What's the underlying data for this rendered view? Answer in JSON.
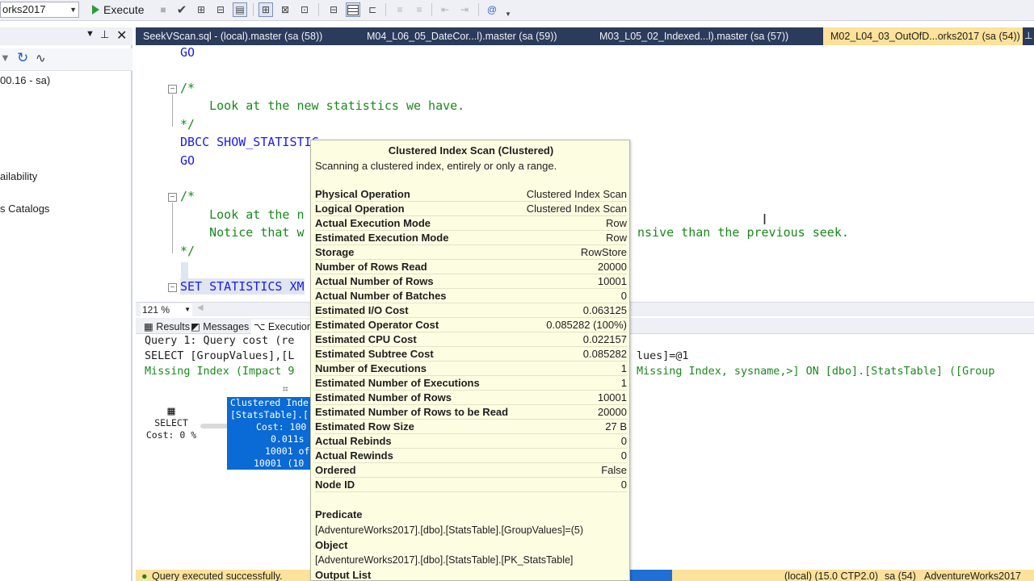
{
  "toolbar": {
    "database": "orks2017",
    "execute_label": "Execute"
  },
  "object_explorer": {
    "items": [
      "00.16 - sa)",
      "ailability",
      "s Catalogs"
    ]
  },
  "tabs": [
    {
      "label": "SeekVScan.sql - (local).master (sa (58))"
    },
    {
      "label": "M04_L06_05_DateCor...l).master (sa (59))"
    },
    {
      "label": "M03_L05_02_Indexed...l).master (sa (57))"
    },
    {
      "label": "M02_L04_03_OutOfD...orks2017 (sa (54))"
    }
  ],
  "editor": {
    "lines": {
      "go1": "GO",
      "c1_open": "/*",
      "c1_text": "    Look at the new statistics we have.",
      "c1_close": "*/",
      "dbcc": "DBCC SHOW_STATISTIC",
      "go2": "GO",
      "c2_open": "/*",
      "c2_text1": "    Look at the n",
      "c2_text2": "    Notice that w",
      "c2_tail": "nsive than the previous seek.",
      "c2_close": "*/",
      "set": "SET STATISTICS XM"
    }
  },
  "zoom": "121 %",
  "results": {
    "tabs": [
      "Results",
      "Messages",
      "Execution p"
    ],
    "query_line": "Query 1: Query cost (re",
    "select_line": "SELECT [GroupValues],[L",
    "select_tail": "lues]=@1",
    "missing_index": "Missing Index (Impact 9",
    "missing_tail": "Missing Index, sysname,>] ON [dbo].[StatsTable] ([Group",
    "select_node": {
      "label": "SELECT",
      "cost": "Cost: 0 %"
    },
    "scan_node": {
      "lines": [
        "Clustered Inde",
        "[StatsTable].[",
        "Cost: 100",
        "0.011s",
        "10001 of",
        "10001 (10"
      ]
    }
  },
  "status": {
    "message": "Query executed successfully.",
    "server": "(local) (15.0 CTP2.0)",
    "user": "sa (54)",
    "database": "AdventureWorks2017"
  },
  "tooltip": {
    "title": "Clustered Index Scan (Clustered)",
    "description": "Scanning a clustered index, entirely or only a range.",
    "properties": [
      {
        "key": "Physical Operation",
        "value": "Clustered Index Scan"
      },
      {
        "key": "Logical Operation",
        "value": "Clustered Index Scan"
      },
      {
        "key": "Actual Execution Mode",
        "value": "Row"
      },
      {
        "key": "Estimated Execution Mode",
        "value": "Row"
      },
      {
        "key": "Storage",
        "value": "RowStore"
      },
      {
        "key": "Number of Rows Read",
        "value": "20000"
      },
      {
        "key": "Actual Number of Rows",
        "value": "10001"
      },
      {
        "key": "Actual Number of Batches",
        "value": "0"
      },
      {
        "key": "Estimated I/O Cost",
        "value": "0.063125"
      },
      {
        "key": "Estimated Operator Cost",
        "value": "0.085282 (100%)"
      },
      {
        "key": "Estimated CPU Cost",
        "value": "0.022157"
      },
      {
        "key": "Estimated Subtree Cost",
        "value": "0.085282"
      },
      {
        "key": "Number of Executions",
        "value": "1"
      },
      {
        "key": "Estimated Number of Executions",
        "value": "1"
      },
      {
        "key": "Estimated Number of Rows",
        "value": "10001"
      },
      {
        "key": "Estimated Number of Rows to be Read",
        "value": "20000"
      },
      {
        "key": "Estimated Row Size",
        "value": "27 B"
      },
      {
        "key": "Actual Rebinds",
        "value": "0"
      },
      {
        "key": "Actual Rewinds",
        "value": "0"
      },
      {
        "key": "Ordered",
        "value": "False"
      },
      {
        "key": "Node ID",
        "value": "0"
      }
    ],
    "predicate_label": "Predicate",
    "predicate_value": "[AdventureWorks2017].[dbo].[StatsTable].[GroupValues]=(5)",
    "object_label": "Object",
    "object_value": "[AdventureWorks2017].[dbo].[StatsTable].[PK_StatsTable]",
    "output_label": "Output List"
  }
}
